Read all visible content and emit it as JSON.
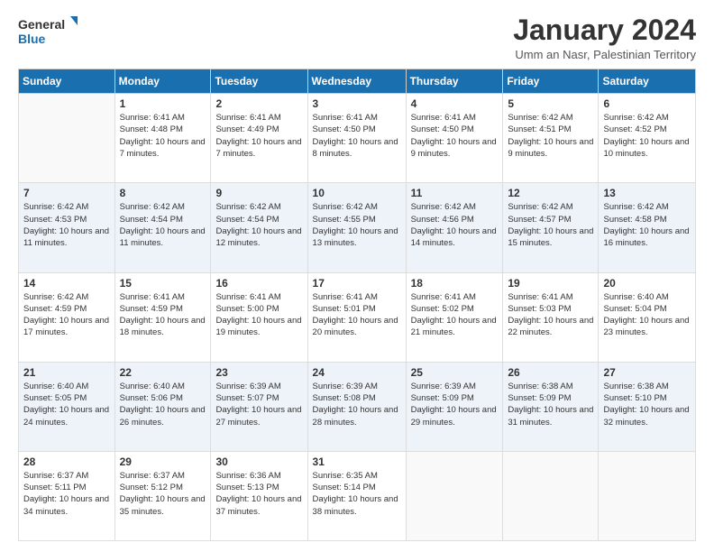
{
  "header": {
    "logo_general": "General",
    "logo_blue": "Blue",
    "month_title": "January 2024",
    "location": "Umm an Nasr, Palestinian Territory"
  },
  "columns": [
    "Sunday",
    "Monday",
    "Tuesday",
    "Wednesday",
    "Thursday",
    "Friday",
    "Saturday"
  ],
  "weeks": [
    [
      {
        "day": "",
        "sunrise": "",
        "sunset": "",
        "daylight": ""
      },
      {
        "day": "1",
        "sunrise": "Sunrise: 6:41 AM",
        "sunset": "Sunset: 4:48 PM",
        "daylight": "Daylight: 10 hours and 7 minutes."
      },
      {
        "day": "2",
        "sunrise": "Sunrise: 6:41 AM",
        "sunset": "Sunset: 4:49 PM",
        "daylight": "Daylight: 10 hours and 7 minutes."
      },
      {
        "day": "3",
        "sunrise": "Sunrise: 6:41 AM",
        "sunset": "Sunset: 4:50 PM",
        "daylight": "Daylight: 10 hours and 8 minutes."
      },
      {
        "day": "4",
        "sunrise": "Sunrise: 6:41 AM",
        "sunset": "Sunset: 4:50 PM",
        "daylight": "Daylight: 10 hours and 9 minutes."
      },
      {
        "day": "5",
        "sunrise": "Sunrise: 6:42 AM",
        "sunset": "Sunset: 4:51 PM",
        "daylight": "Daylight: 10 hours and 9 minutes."
      },
      {
        "day": "6",
        "sunrise": "Sunrise: 6:42 AM",
        "sunset": "Sunset: 4:52 PM",
        "daylight": "Daylight: 10 hours and 10 minutes."
      }
    ],
    [
      {
        "day": "7",
        "sunrise": "Sunrise: 6:42 AM",
        "sunset": "Sunset: 4:53 PM",
        "daylight": "Daylight: 10 hours and 11 minutes."
      },
      {
        "day": "8",
        "sunrise": "Sunrise: 6:42 AM",
        "sunset": "Sunset: 4:54 PM",
        "daylight": "Daylight: 10 hours and 11 minutes."
      },
      {
        "day": "9",
        "sunrise": "Sunrise: 6:42 AM",
        "sunset": "Sunset: 4:54 PM",
        "daylight": "Daylight: 10 hours and 12 minutes."
      },
      {
        "day": "10",
        "sunrise": "Sunrise: 6:42 AM",
        "sunset": "Sunset: 4:55 PM",
        "daylight": "Daylight: 10 hours and 13 minutes."
      },
      {
        "day": "11",
        "sunrise": "Sunrise: 6:42 AM",
        "sunset": "Sunset: 4:56 PM",
        "daylight": "Daylight: 10 hours and 14 minutes."
      },
      {
        "day": "12",
        "sunrise": "Sunrise: 6:42 AM",
        "sunset": "Sunset: 4:57 PM",
        "daylight": "Daylight: 10 hours and 15 minutes."
      },
      {
        "day": "13",
        "sunrise": "Sunrise: 6:42 AM",
        "sunset": "Sunset: 4:58 PM",
        "daylight": "Daylight: 10 hours and 16 minutes."
      }
    ],
    [
      {
        "day": "14",
        "sunrise": "Sunrise: 6:42 AM",
        "sunset": "Sunset: 4:59 PM",
        "daylight": "Daylight: 10 hours and 17 minutes."
      },
      {
        "day": "15",
        "sunrise": "Sunrise: 6:41 AM",
        "sunset": "Sunset: 4:59 PM",
        "daylight": "Daylight: 10 hours and 18 minutes."
      },
      {
        "day": "16",
        "sunrise": "Sunrise: 6:41 AM",
        "sunset": "Sunset: 5:00 PM",
        "daylight": "Daylight: 10 hours and 19 minutes."
      },
      {
        "day": "17",
        "sunrise": "Sunrise: 6:41 AM",
        "sunset": "Sunset: 5:01 PM",
        "daylight": "Daylight: 10 hours and 20 minutes."
      },
      {
        "day": "18",
        "sunrise": "Sunrise: 6:41 AM",
        "sunset": "Sunset: 5:02 PM",
        "daylight": "Daylight: 10 hours and 21 minutes."
      },
      {
        "day": "19",
        "sunrise": "Sunrise: 6:41 AM",
        "sunset": "Sunset: 5:03 PM",
        "daylight": "Daylight: 10 hours and 22 minutes."
      },
      {
        "day": "20",
        "sunrise": "Sunrise: 6:40 AM",
        "sunset": "Sunset: 5:04 PM",
        "daylight": "Daylight: 10 hours and 23 minutes."
      }
    ],
    [
      {
        "day": "21",
        "sunrise": "Sunrise: 6:40 AM",
        "sunset": "Sunset: 5:05 PM",
        "daylight": "Daylight: 10 hours and 24 minutes."
      },
      {
        "day": "22",
        "sunrise": "Sunrise: 6:40 AM",
        "sunset": "Sunset: 5:06 PM",
        "daylight": "Daylight: 10 hours and 26 minutes."
      },
      {
        "day": "23",
        "sunrise": "Sunrise: 6:39 AM",
        "sunset": "Sunset: 5:07 PM",
        "daylight": "Daylight: 10 hours and 27 minutes."
      },
      {
        "day": "24",
        "sunrise": "Sunrise: 6:39 AM",
        "sunset": "Sunset: 5:08 PM",
        "daylight": "Daylight: 10 hours and 28 minutes."
      },
      {
        "day": "25",
        "sunrise": "Sunrise: 6:39 AM",
        "sunset": "Sunset: 5:09 PM",
        "daylight": "Daylight: 10 hours and 29 minutes."
      },
      {
        "day": "26",
        "sunrise": "Sunrise: 6:38 AM",
        "sunset": "Sunset: 5:09 PM",
        "daylight": "Daylight: 10 hours and 31 minutes."
      },
      {
        "day": "27",
        "sunrise": "Sunrise: 6:38 AM",
        "sunset": "Sunset: 5:10 PM",
        "daylight": "Daylight: 10 hours and 32 minutes."
      }
    ],
    [
      {
        "day": "28",
        "sunrise": "Sunrise: 6:37 AM",
        "sunset": "Sunset: 5:11 PM",
        "daylight": "Daylight: 10 hours and 34 minutes."
      },
      {
        "day": "29",
        "sunrise": "Sunrise: 6:37 AM",
        "sunset": "Sunset: 5:12 PM",
        "daylight": "Daylight: 10 hours and 35 minutes."
      },
      {
        "day": "30",
        "sunrise": "Sunrise: 6:36 AM",
        "sunset": "Sunset: 5:13 PM",
        "daylight": "Daylight: 10 hours and 37 minutes."
      },
      {
        "day": "31",
        "sunrise": "Sunrise: 6:35 AM",
        "sunset": "Sunset: 5:14 PM",
        "daylight": "Daylight: 10 hours and 38 minutes."
      },
      {
        "day": "",
        "sunrise": "",
        "sunset": "",
        "daylight": ""
      },
      {
        "day": "",
        "sunrise": "",
        "sunset": "",
        "daylight": ""
      },
      {
        "day": "",
        "sunrise": "",
        "sunset": "",
        "daylight": ""
      }
    ]
  ]
}
